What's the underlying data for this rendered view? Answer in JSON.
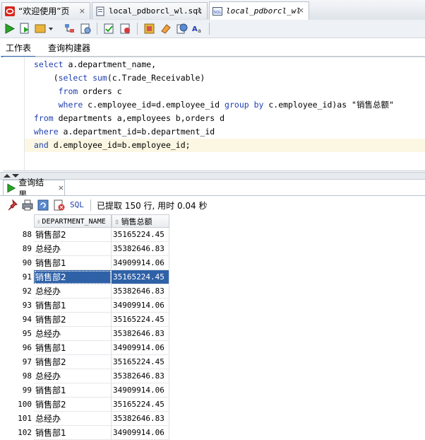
{
  "doc_tabs": [
    {
      "label": "“欢迎使用”页",
      "close": "×"
    },
    {
      "label": "local_pdborcl_wl.sql",
      "close": "×"
    },
    {
      "label": "local_pdborcl_wl",
      "close": "×"
    }
  ],
  "subtabs": {
    "worksheet": "工作表",
    "query_builder": "查询构建器"
  },
  "editor": {
    "lines": [
      {
        "kw1": "select",
        "t1": " a.department_name,",
        "kw2": "",
        "t2": "",
        "kw3": "",
        "t3": ""
      },
      {
        "kw1": "",
        "t1": "    (",
        "kw2": "select sum",
        "t2": "(c.Trade_Receivable)",
        "kw3": "",
        "t3": ""
      },
      {
        "kw1": "",
        "t1": "     ",
        "kw2": "from",
        "t2": " orders c",
        "kw3": "",
        "t3": ""
      },
      {
        "kw1": "",
        "t1": "     ",
        "kw2": "where",
        "t2": " c.employee_id=d.employee_id ",
        "kw3": "group by",
        "t3": " c.employee_id)as \"销售总额\""
      },
      {
        "kw1": "from",
        "t1": " departments a,employees b,orders d",
        "kw2": "",
        "t2": "",
        "kw3": "",
        "t3": ""
      },
      {
        "kw1": "where",
        "t1": " a.department_id=b.department_id",
        "kw2": "",
        "t2": "",
        "kw3": "",
        "t3": ""
      },
      {
        "kw1": "and",
        "t1": " d.employee_id=b.employee_id;",
        "kw2": "",
        "t2": "",
        "kw3": "",
        "t3": ""
      }
    ]
  },
  "results": {
    "tab_label": "查询结果",
    "tab_close": "×",
    "sql_label": "SQL",
    "status": "已提取 150 行, 用时 0.04 秒",
    "columns": [
      "DEPARTMENT_NAME",
      "销售总额"
    ],
    "rows": [
      {
        "n": "88",
        "dept": "销售部2",
        "total": "35165224.45"
      },
      {
        "n": "89",
        "dept": "总经办",
        "total": "35382646.83"
      },
      {
        "n": "90",
        "dept": "销售部1",
        "total": "34909914.06"
      },
      {
        "n": "91",
        "dept": "销售部2",
        "total": "35165224.45"
      },
      {
        "n": "92",
        "dept": "总经办",
        "total": "35382646.83"
      },
      {
        "n": "93",
        "dept": "销售部1",
        "total": "34909914.06"
      },
      {
        "n": "94",
        "dept": "销售部2",
        "total": "35165224.45"
      },
      {
        "n": "95",
        "dept": "总经办",
        "total": "35382646.83"
      },
      {
        "n": "96",
        "dept": "销售部1",
        "total": "34909914.06"
      },
      {
        "n": "97",
        "dept": "销售部2",
        "total": "35165224.45"
      },
      {
        "n": "98",
        "dept": "总经办",
        "total": "35382646.83"
      },
      {
        "n": "99",
        "dept": "销售部1",
        "total": "34909914.06"
      },
      {
        "n": "100",
        "dept": "销售部2",
        "total": "35165224.45"
      },
      {
        "n": "101",
        "dept": "总经办",
        "total": "35382646.83"
      },
      {
        "n": "102",
        "dept": "销售部1",
        "total": "34909914.06"
      }
    ],
    "selected_row": "91"
  },
  "colors": {
    "accent": "#2f61a7",
    "keyword": "#1f3fb0",
    "current_line": "#fbf7e3"
  }
}
